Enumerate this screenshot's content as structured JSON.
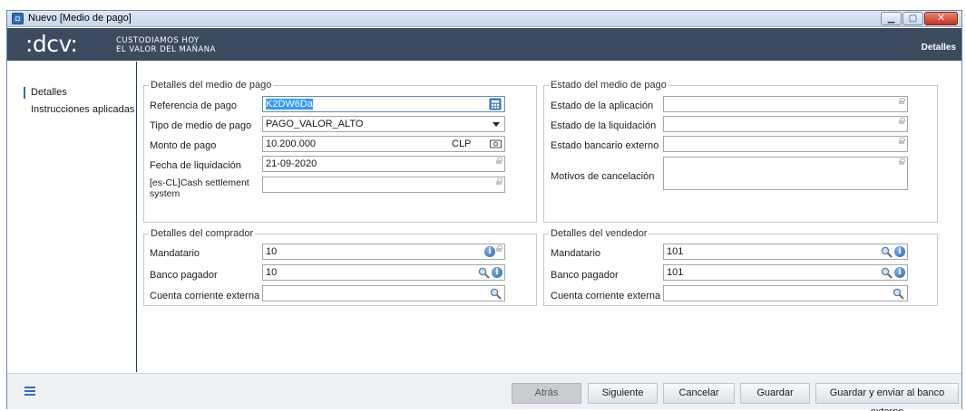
{
  "window": {
    "title": "Nuevo [Medio de pago]"
  },
  "brand": {
    "logo": ":dcv:",
    "tagline_1": "CUSTODIAMOS HOY",
    "tagline_2": "EL VALOR DEL MAÑANA",
    "section": "Detalles"
  },
  "sidebar": {
    "items": [
      {
        "label": "Detalles",
        "active": true
      },
      {
        "label": "Instrucciones aplicadas",
        "active": false
      }
    ]
  },
  "payment_details": {
    "title": "Detalles del medio de pago",
    "fields": {
      "referencia": {
        "label": "Referencia de pago",
        "value": "K2DW6Da"
      },
      "tipo": {
        "label": "Tipo de medio de pago",
        "value": "PAGO_VALOR_ALTO"
      },
      "monto": {
        "label": "Monto de pago",
        "value": "10.200.000",
        "currency": "CLP"
      },
      "fecha": {
        "label": "Fecha de liquidación",
        "value": "21-09-2020"
      },
      "cash": {
        "label_1": "[es-CL]Cash settlement",
        "label_2": "system",
        "value": ""
      }
    }
  },
  "payment_state": {
    "title": "Estado del medio de pago",
    "fields": {
      "aplicacion": {
        "label": "Estado de la aplicación",
        "value": ""
      },
      "liquidacion": {
        "label": "Estado de la liquidación",
        "value": ""
      },
      "bancario": {
        "label": "Estado bancario externo",
        "value": ""
      },
      "motivos": {
        "label": "Motivos de cancelación",
        "value": ""
      }
    }
  },
  "buyer": {
    "title": "Detalles del comprador",
    "fields": {
      "mandatario": {
        "label": "Mandatario",
        "value": "10"
      },
      "banco": {
        "label": "Banco pagador",
        "value": "10"
      },
      "cuenta": {
        "label": "Cuenta corriente externa",
        "value": ""
      }
    }
  },
  "seller": {
    "title": "Detalles del vendedor",
    "fields": {
      "mandatario": {
        "label": "Mandatario",
        "value": "101"
      },
      "banco": {
        "label": "Banco pagador",
        "value": "101"
      },
      "cuenta": {
        "label": "Cuenta corriente externa",
        "value": ""
      }
    }
  },
  "footer": {
    "buttons": {
      "atras": "Atrás",
      "siguiente": "Siguiente",
      "cancelar": "Cancelar",
      "guardar": "Guardar",
      "guardar_enviar": "Guardar y enviar al banco externo"
    }
  },
  "icons": {
    "app": "window-app-icon",
    "minimize": "minimize-icon",
    "maximize": "maximize-icon",
    "close": "close-icon",
    "calculator": "calculator-icon",
    "currency": "currency-note-icon",
    "lock": "lock-icon",
    "search": "search-icon",
    "info": "info-icon",
    "menu": "menu-icon"
  },
  "colors": {
    "brand_bar": "#3c4b5f",
    "accent": "#2f6fb5",
    "selection": "#3399ff",
    "footer_bg": "#eef1f4"
  }
}
